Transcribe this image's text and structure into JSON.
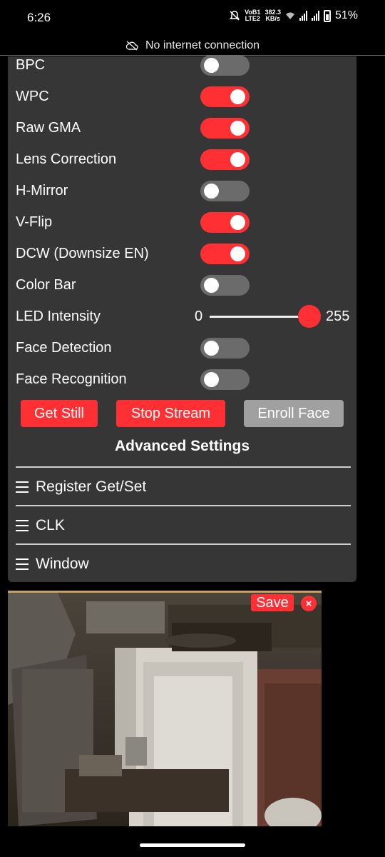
{
  "status_bar": {
    "time": "6:26",
    "network_top": "VoB1",
    "network_bottom": "LTE2",
    "speed_top": "382.3",
    "speed_bottom": "KB/s",
    "battery": "51%"
  },
  "banner": {
    "text": "No internet connection",
    "icon": "cloud-off-icon"
  },
  "settings": [
    {
      "label": "BPC",
      "type": "toggle",
      "on": false
    },
    {
      "label": "WPC",
      "type": "toggle",
      "on": true
    },
    {
      "label": "Raw GMA",
      "type": "toggle",
      "on": true
    },
    {
      "label": "Lens Correction",
      "type": "toggle",
      "on": true
    },
    {
      "label": "H-Mirror",
      "type": "toggle",
      "on": false
    },
    {
      "label": "V-Flip",
      "type": "toggle",
      "on": true
    },
    {
      "label": "DCW (Downsize EN)",
      "type": "toggle",
      "on": true
    },
    {
      "label": "Color Bar",
      "type": "toggle",
      "on": false
    },
    {
      "label": "LED Intensity",
      "type": "slider",
      "min": "0",
      "max": "255",
      "value": 255
    },
    {
      "label": "Face Detection",
      "type": "toggle",
      "on": false
    },
    {
      "label": "Face Recognition",
      "type": "toggle",
      "on": false
    }
  ],
  "buttons": {
    "get_still": "Get Still",
    "stop_stream": "Stop Stream",
    "enroll_face": "Enroll Face"
  },
  "advanced": {
    "title": "Advanced Settings",
    "sections": [
      "Register Get/Set",
      "CLK",
      "Window"
    ]
  },
  "stream": {
    "save_label": "Save",
    "close_label": "×"
  },
  "colors": {
    "accent": "#ff3034",
    "panel": "#363636",
    "toggle_off": "#6b6b6b",
    "button_disabled": "#a0a0a0"
  }
}
